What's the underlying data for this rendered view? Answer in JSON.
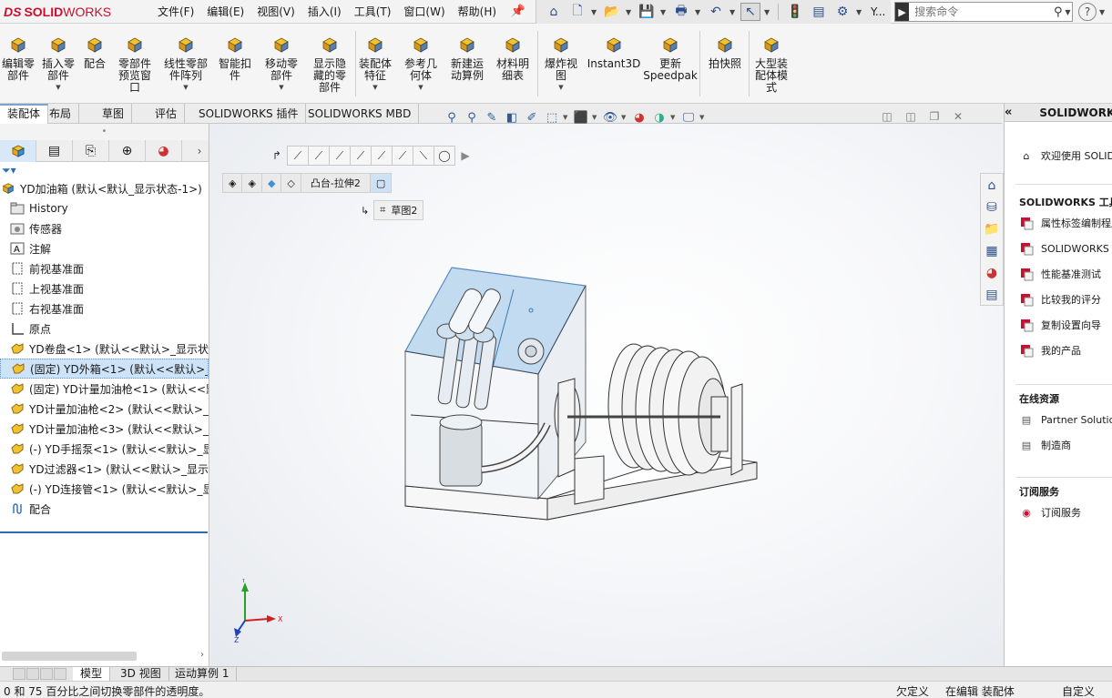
{
  "app": {
    "logo_ds": "DS",
    "logo_solid": "SOLID",
    "logo_works": "WORKS"
  },
  "menus": [
    "文件(F)",
    "编辑(E)",
    "视图(V)",
    "插入(I)",
    "工具(T)",
    "窗口(W)",
    "帮助(H)"
  ],
  "quickbar": {
    "user_initial": "Y..."
  },
  "search": {
    "placeholder": "搜索命令"
  },
  "help": {
    "label": "?"
  },
  "ribbon": [
    {
      "label": "编辑零\n部件",
      "icon": "edit-component-icon",
      "caret": false
    },
    {
      "label": "插入零\n部件",
      "icon": "insert-component-icon",
      "caret": true
    },
    {
      "label": "配合",
      "icon": "mate-icon",
      "caret": false
    },
    {
      "label": "零部件\n预览窗\n口",
      "icon": "component-preview-icon",
      "caret": false
    },
    {
      "label": "线性零部\n件阵列",
      "icon": "linear-pattern-icon",
      "caret": true
    },
    {
      "label": "智能扣\n件",
      "icon": "smart-fasteners-icon",
      "caret": false
    },
    {
      "label": "移动零\n部件",
      "icon": "move-component-icon",
      "caret": true
    },
    {
      "label": "显示隐\n藏的零\n部件",
      "icon": "show-hidden-icon",
      "caret": false
    },
    {
      "label": "装配体\n特征",
      "icon": "assembly-feature-icon",
      "caret": true
    },
    {
      "label": "参考几\n何体",
      "icon": "reference-geometry-icon",
      "caret": true
    },
    {
      "label": "新建运\n动算例",
      "icon": "new-motion-study-icon",
      "caret": false
    },
    {
      "label": "材料明\n细表",
      "icon": "bill-of-materials-icon",
      "caret": false
    },
    {
      "label": "爆炸视\n图",
      "icon": "exploded-view-icon",
      "caret": true
    },
    {
      "label": "Instant3D",
      "icon": "instant3d-icon",
      "caret": false
    },
    {
      "label": "更新\nSpeedpak",
      "icon": "speedpak-icon",
      "caret": false
    },
    {
      "label": "拍快照",
      "icon": "snapshot-icon",
      "caret": false
    },
    {
      "label": "大型装\n配体模\n式",
      "icon": "large-assembly-icon",
      "caret": false
    }
  ],
  "tabs": [
    "装配体",
    "布局",
    "草图",
    "评估",
    "SOLIDWORKS 插件",
    "SOLIDWORKS MBD"
  ],
  "tree": {
    "root": "YD加油箱 (默认<默认_显示状态-1>)",
    "items": [
      {
        "label": "History",
        "icon": "history-folder-icon"
      },
      {
        "label": "传感器",
        "icon": "sensor-icon"
      },
      {
        "label": "注解",
        "icon": "annotation-icon"
      },
      {
        "label": "前视基准面",
        "icon": "plane-icon"
      },
      {
        "label": "上视基准面",
        "icon": "plane-icon"
      },
      {
        "label": "右视基准面",
        "icon": "plane-icon"
      },
      {
        "label": "原点",
        "icon": "origin-icon"
      },
      {
        "label": "YD卷盘<1> (默认<<默认>_显示状态",
        "icon": "component-icon"
      },
      {
        "label": "(固定) YD外箱<1> (默认<<默认>_显",
        "icon": "component-icon"
      },
      {
        "label": "(固定) YD计量加油枪<1> (默认<<默认",
        "icon": "component-icon"
      },
      {
        "label": "YD计量加油枪<2> (默认<<默认>_显",
        "icon": "component-icon"
      },
      {
        "label": "YD计量加油枪<3> (默认<<默认>_显",
        "icon": "component-icon"
      },
      {
        "label": "(-) YD手摇泵<1> (默认<<默认>_显示",
        "icon": "component-icon"
      },
      {
        "label": "YD过滤器<1> (默认<<默认>_显示状",
        "icon": "component-icon"
      },
      {
        "label": "(-) YD连接管<1> (默认<<默认>_显示",
        "icon": "component-icon"
      },
      {
        "label": "配合",
        "icon": "mates-folder-icon"
      }
    ],
    "selected_index": 8
  },
  "breadcrumb": {
    "feature": "凸台-拉伸2",
    "sketch": "草图2"
  },
  "taskpane": {
    "title": "SOLIDWORKS",
    "welcome": "欢迎使用 SOLIDWORKS",
    "tools_title": "SOLIDWORKS 工具",
    "tools": [
      "属性标签编制程序",
      "SOLIDWORKS Rx",
      "性能基准测试",
      "比较我的评分",
      "复制设置向导",
      "我的产品"
    ],
    "online_title": "在线资源",
    "online": [
      "Partner Solutions",
      "制造商"
    ],
    "subscription_title": "订阅服务",
    "subscription": [
      "订阅服务"
    ]
  },
  "bottom_tabs": [
    "模型",
    "3D 视图",
    "运动算例 1"
  ],
  "status": {
    "message": "0 和 75 百分比之间切换零部件的透明度。",
    "definition": "欠定义",
    "editing": "在编辑 装配体",
    "custom": "自定义"
  },
  "colors": {
    "accent": "#2a6db5",
    "brand_red": "#c8102e",
    "selection": "#cde3f7"
  }
}
